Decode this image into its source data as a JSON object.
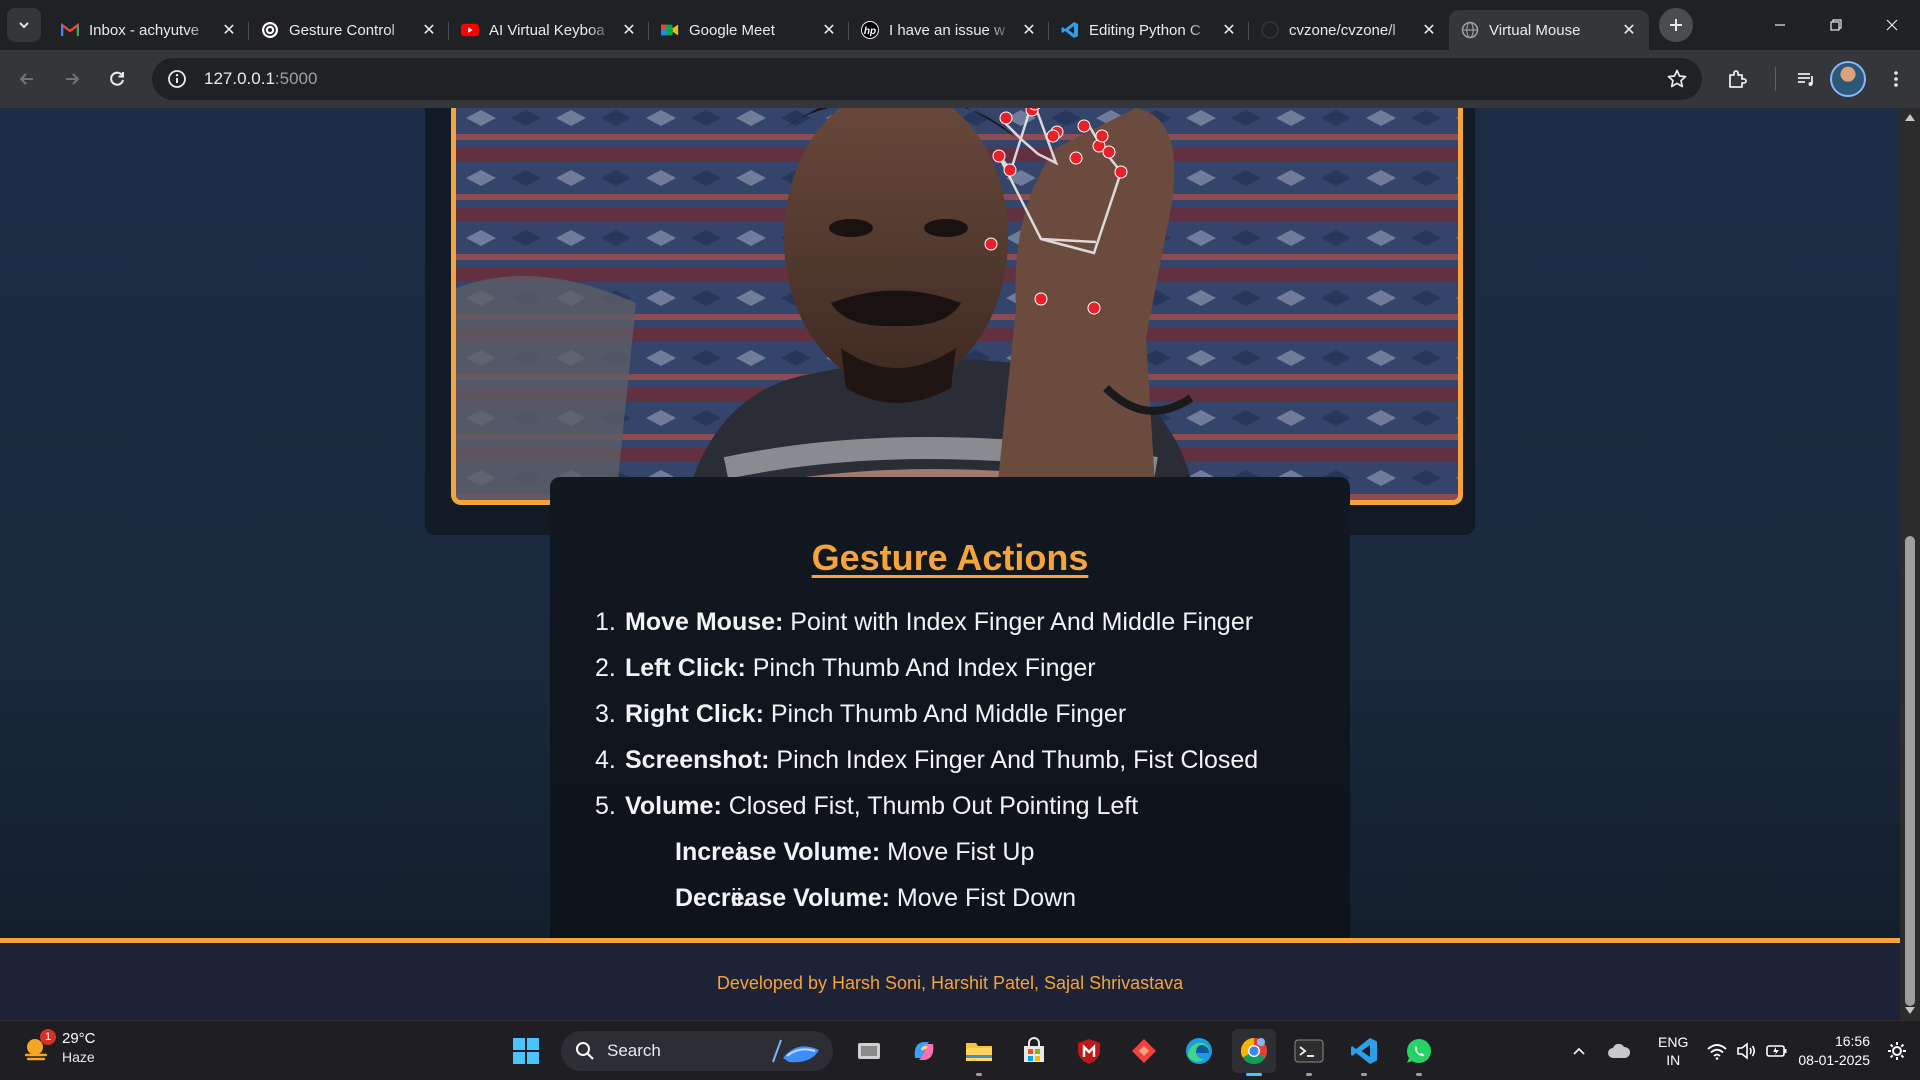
{
  "browser": {
    "tabs": [
      {
        "title": "Inbox - achyutve",
        "icon": "gmail-icon",
        "color": "#ea4335"
      },
      {
        "title": "Gesture Control",
        "icon": "chatgpt-icon",
        "color": "#ffffff"
      },
      {
        "title": "AI Virtual Keyboa",
        "icon": "youtube-icon",
        "color": "#ff0000"
      },
      {
        "title": "Google Meet",
        "icon": "google-meet-icon",
        "color": "#00ac47"
      },
      {
        "title": "I have an issue w",
        "icon": "hp-icon",
        "color": "#e8eaed"
      },
      {
        "title": "Editing Python C",
        "icon": "vscode-icon",
        "color": "#2f9ee9"
      },
      {
        "title": "cvzone/cvzone/l",
        "icon": "github-icon",
        "color": "#e8eaed"
      },
      {
        "title": "Virtual Mouse",
        "icon": "globe-icon",
        "color": "#9aa0a6",
        "active": true
      }
    ],
    "url_host": "127.0.0.1",
    "url_port": ":5000"
  },
  "page": {
    "gesture_title": "Gesture Actions",
    "actions": [
      {
        "num": "1.",
        "label": "Move Mouse:",
        "desc": " Point with Index Finger And Middle Finger"
      },
      {
        "num": "2.",
        "label": "Left Click:",
        "desc": " Pinch Thumb And Index Finger"
      },
      {
        "num": "3.",
        "label": "Right Click:",
        "desc": " Pinch Thumb And Middle Finger"
      },
      {
        "num": "4.",
        "label": "Screenshot:",
        "desc": " Pinch Index Finger And Thumb, Fist Closed"
      },
      {
        "num": "5.",
        "label": "Volume:",
        "desc": " Closed Fist, Thumb Out Pointing Left"
      }
    ],
    "sub_actions": [
      {
        "num": "i.",
        "label": "Increase Volume:",
        "desc": " Move Fist Up"
      },
      {
        "num": "ii.",
        "label": "Decrease Volume:",
        "desc": " Move Fist Down"
      }
    ],
    "footer": "Developed by Harsh Soni, Harshit Patel, Sajal Shrivastava",
    "accent_color": "#f5a33b"
  },
  "taskbar": {
    "weather_temp": "29°C",
    "weather_desc": "Haze",
    "weather_badge": "1",
    "search_label": "Search",
    "lang_1": "ENG",
    "lang_2": "IN",
    "time": "16:56",
    "date": "08-01-2025"
  }
}
